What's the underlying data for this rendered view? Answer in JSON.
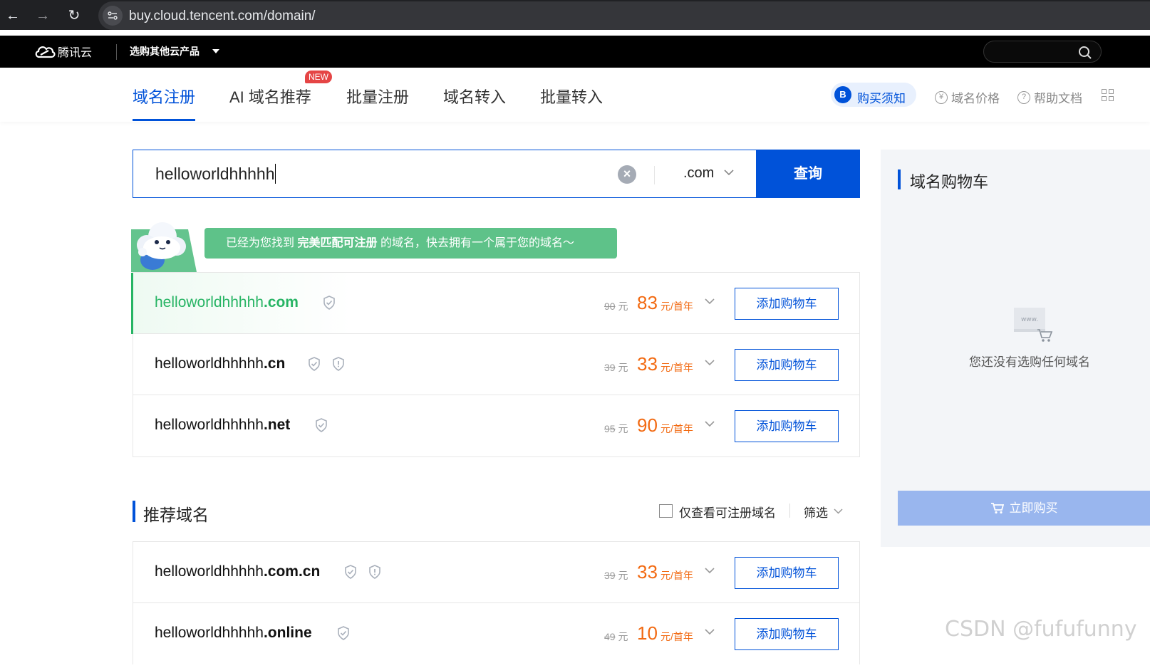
{
  "browser": {
    "url": "buy.cloud.tencent.com/domain/",
    "back_icon": "arrow-left-icon",
    "forward_icon": "arrow-right-icon",
    "reload_icon": "reload-icon"
  },
  "topnav": {
    "brand": "腾讯云",
    "products_menu": "选购其他云产品"
  },
  "tabs": [
    {
      "label": "域名注册",
      "active": true
    },
    {
      "label": "AI 域名推荐",
      "badge": "NEW"
    },
    {
      "label": "批量注册"
    },
    {
      "label": "域名转入"
    },
    {
      "label": "批量转入"
    }
  ],
  "toplinks": {
    "notice": "购买须知",
    "notice_icon": "B",
    "price": "域名价格",
    "price_icon": "¥",
    "help": "帮助文档",
    "help_icon": "?"
  },
  "search": {
    "value": "helloworldhhhhh",
    "suffix": ".com",
    "button": "查询"
  },
  "banner": {
    "prefix": "已经为您找到",
    "emphasis": "完美匹配可注册",
    "suffix": "的域名，快去拥有一个属于您的域名～"
  },
  "results": [
    {
      "name": "helloworldhhhhh",
      "tld": ".com",
      "old_price": "90",
      "price": "83",
      "unit": "元/首年",
      "button": "添加购物车",
      "highlight": true,
      "shields": 1
    },
    {
      "name": "helloworldhhhhh",
      "tld": ".cn",
      "old_price": "39",
      "price": "33",
      "unit": "元/首年",
      "button": "添加购物车",
      "shields": 2
    },
    {
      "name": "helloworldhhhhh",
      "tld": ".net",
      "old_price": "95",
      "price": "90",
      "unit": "元/首年",
      "button": "添加购物车",
      "shields": 1
    }
  ],
  "old_price_unit": "元",
  "recommend": {
    "title": "推荐域名",
    "checkbox_label": "仅查看可注册域名",
    "filter": "筛选",
    "items": [
      {
        "name": "helloworldhhhhh",
        "tld": ".com.cn",
        "old_price": "39",
        "price": "33",
        "unit": "元/首年",
        "button": "添加购物车",
        "shields": 2
      },
      {
        "name": "helloworldhhhhh",
        "tld": ".online",
        "old_price": "49",
        "price": "10",
        "unit": "元/首年",
        "button": "添加购物车",
        "shields": 1
      }
    ]
  },
  "cart": {
    "title": "域名购物车",
    "empty_text": "您还没有选购任何域名",
    "empty_icon_text": "www.",
    "buy_button": "立即购买"
  },
  "watermark": "CSDN @fufufunny",
  "colors": {
    "brand_blue": "#0052d9",
    "price_orange": "#f26a12",
    "success_green": "#27b464",
    "banner_green": "#5ec289"
  }
}
